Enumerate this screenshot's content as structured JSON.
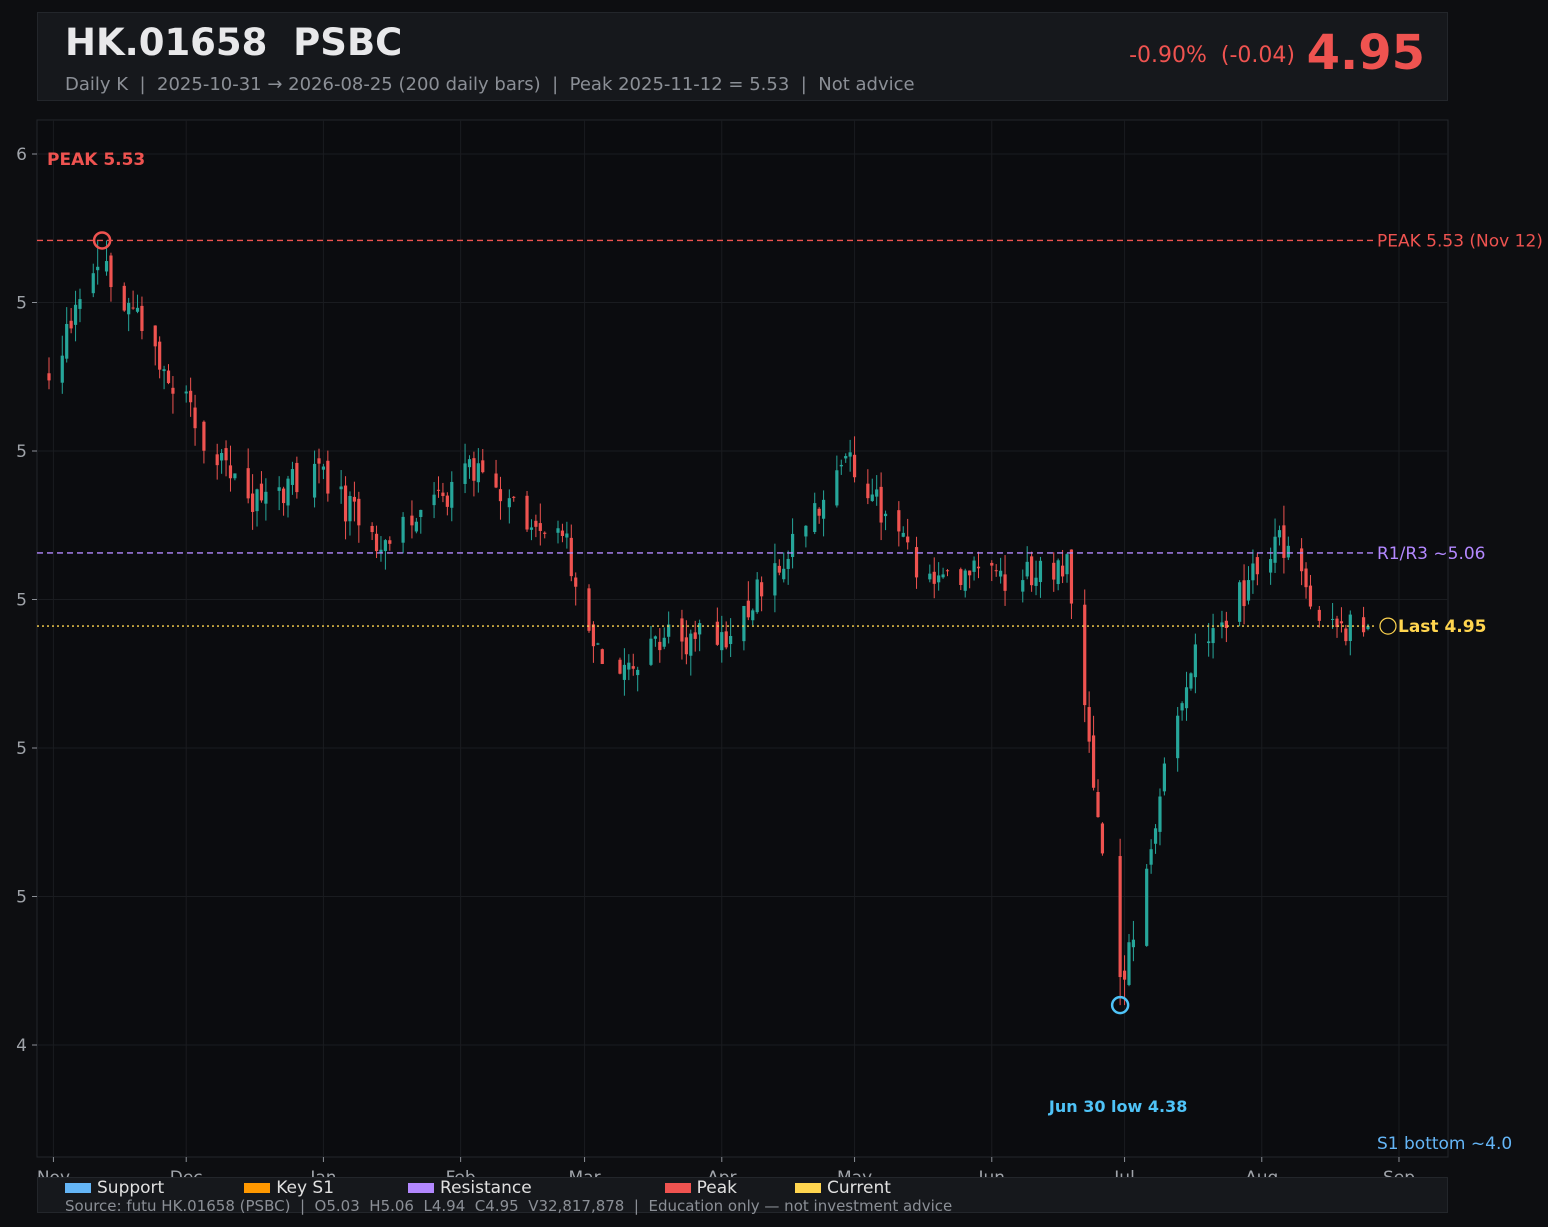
{
  "header": {
    "title": "HK.01658  PSBC",
    "subtitle": "Daily K  |  2025-10-31 → 2026-08-25 (200 daily bars)  |  Peak 2025-11-12 = 5.53  |  Not advice",
    "change": "-0.90%  (-0.04)",
    "price": "4.95",
    "price_color": "#ef5350"
  },
  "legend": [
    {
      "label": "Support",
      "color": "#64b5f6"
    },
    {
      "label": "Key S1",
      "color": "#ff9800"
    },
    {
      "label": "Resistance",
      "color": "#b388ff"
    },
    {
      "label": "Peak",
      "color": "#ef5350"
    },
    {
      "label": "Current",
      "color": "#ffd54f"
    }
  ],
  "footer": {
    "source": "Source: futu HK.01658 (PSBC)  |  O5.03  H5.06  L4.94  C4.95  V32,817,878  |  Education only — not investment advice"
  },
  "chart_data": {
    "type": "candlestick",
    "title": "HK.01658  PSBC",
    "x_start": "2025-10-31",
    "x_end": "2026-08-25",
    "bars": 200,
    "x_tick_labels": [
      "Nov",
      "Dec",
      "Jan",
      "Feb",
      "Mar",
      "Apr",
      "May",
      "Jun",
      "Jul",
      "Aug",
      "Sep"
    ],
    "y_tick_labels": [
      "6",
      "5",
      "5",
      "5",
      "5",
      "5",
      "4"
    ],
    "ylim": [
      4.32,
      5.66
    ],
    "up_color": "#26a69a",
    "down_color": "#ef5350",
    "grid": true,
    "anchor_points": [
      {
        "date": "2025-10-31",
        "close": 5.34
      },
      {
        "date": "2025-11-12",
        "close": 5.5
      },
      {
        "date": "2025-11-25",
        "close": 5.36
      },
      {
        "date": "2025-12-03",
        "close": 5.26
      },
      {
        "date": "2025-12-15",
        "close": 5.13
      },
      {
        "date": "2025-12-30",
        "close": 5.18
      },
      {
        "date": "2026-01-15",
        "close": 5.07
      },
      {
        "date": "2026-02-03",
        "close": 5.18
      },
      {
        "date": "2026-02-25",
        "close": 5.07
      },
      {
        "date": "2026-03-05",
        "close": 4.88
      },
      {
        "date": "2026-03-20",
        "close": 4.93
      },
      {
        "date": "2026-04-02",
        "close": 4.93
      },
      {
        "date": "2026-04-30",
        "close": 5.2
      },
      {
        "date": "2026-05-15",
        "close": 5.04
      },
      {
        "date": "2026-06-01",
        "close": 5.02
      },
      {
        "date": "2026-06-18",
        "close": 5.05
      },
      {
        "date": "2026-06-30",
        "close": 4.4
      },
      {
        "date": "2026-07-15",
        "close": 4.88
      },
      {
        "date": "2026-08-05",
        "close": 5.08
      },
      {
        "date": "2026-08-15",
        "close": 4.95
      },
      {
        "date": "2026-08-25",
        "close": 4.95
      }
    ],
    "levels": [
      {
        "name": "peak",
        "value": 5.53,
        "label": "PEAK 5.53 (Nov 12)",
        "color": "#ef5350",
        "style": "dashed"
      },
      {
        "name": "resistance",
        "value": 5.06,
        "label": "R1/R3 ~5.06",
        "color": "#b388ff",
        "style": "dashed"
      },
      {
        "name": "current",
        "value": 4.95,
        "label": "Last 4.95",
        "color": "#ffd54f",
        "style": "dotted"
      }
    ],
    "annotations": [
      {
        "name": "peak-label",
        "text": "PEAK 5.53",
        "date": "2025-11-12",
        "value": 5.53,
        "color": "#ef5350"
      },
      {
        "name": "low-label",
        "text": "Jun 30 low 4.38",
        "date": "2026-06-30",
        "value": 4.38,
        "color": "#4fc3f7"
      },
      {
        "name": "s1-label",
        "text": "S1 bottom ~4.0",
        "color": "#64b5f6"
      }
    ]
  }
}
